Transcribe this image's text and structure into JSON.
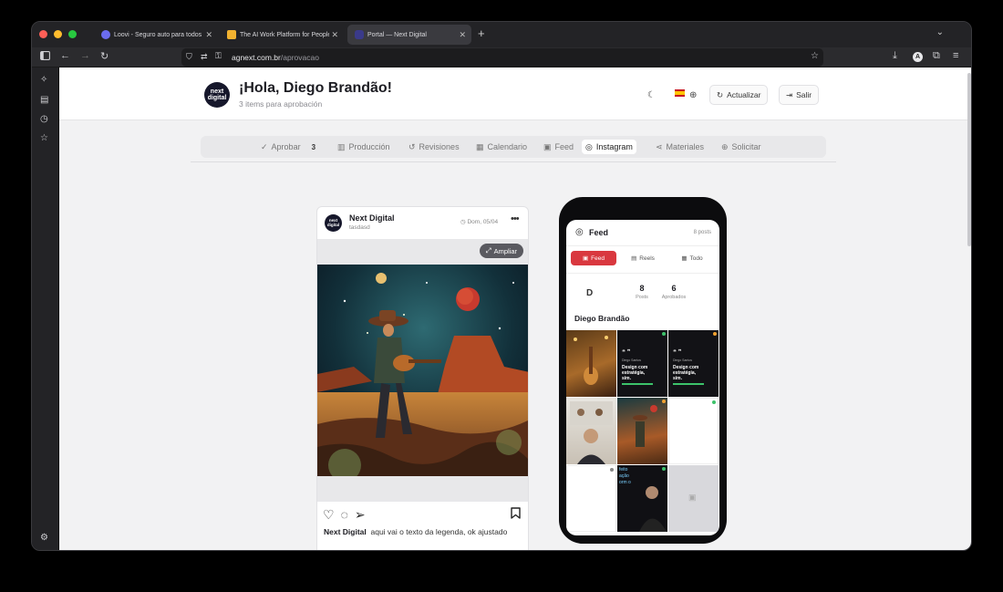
{
  "browser": {
    "tabs": [
      {
        "title": "Loovi - Seguro auto para todos",
        "favicon_color": "#6b6cf0"
      },
      {
        "title": "The AI Work Platform for People",
        "favicon_color": "#f2b230"
      },
      {
        "title": "Portal — Next Digital",
        "favicon_color": "#3a3a8a"
      }
    ],
    "url_host": "agnext.com.br",
    "url_path": "/aprovacao",
    "new_tab": "+",
    "tab_close": "✕"
  },
  "header": {
    "logo_text": "next digital",
    "greeting": "¡Hola, Diego Brandão!",
    "subtitle": "3 items para aprobación",
    "refresh_label": "Actualizar",
    "logout_label": "Salir"
  },
  "nav": {
    "items": [
      {
        "label": "Aprobar",
        "icon": "check-icon",
        "count": "3"
      },
      {
        "label": "Producción",
        "icon": "building-icon"
      },
      {
        "label": "Revisiones",
        "icon": "history-icon"
      },
      {
        "label": "Calendario",
        "icon": "calendar-icon"
      },
      {
        "label": "Feed",
        "icon": "image-icon"
      },
      {
        "label": "Instagram",
        "icon": "instagram-icon",
        "active": true
      },
      {
        "label": "Materiales",
        "icon": "share-icon"
      },
      {
        "label": "Solicitar",
        "icon": "plus-circle-icon"
      }
    ]
  },
  "post": {
    "avatar_text": "next digital",
    "account_name": "Next Digital",
    "handle": "tasdasd",
    "date": "Dom, 05/04",
    "expand_label": "Ampliar",
    "caption_author": "Next Digital",
    "caption_text": "aqui vai o texto da legenda, ok ajustado"
  },
  "phone": {
    "feed_title": "Feed",
    "posts_count_label": "8 posts",
    "tabs": [
      {
        "label": "Feed",
        "active": true
      },
      {
        "label": "Reels"
      },
      {
        "label": "Todo"
      }
    ],
    "profile_initial": "D",
    "stats": [
      {
        "value": "8",
        "label": "Posts"
      },
      {
        "value": "6",
        "label": "Aprobados"
      }
    ],
    "profile_name": "Diego Brandão",
    "grid_text": {
      "quote_mark": "❝ ❞",
      "card_author": "Diego Santos",
      "card_headline": "Design com estratégia, sim.",
      "card_partial": "feito ação orm o"
    }
  },
  "colors": {
    "accent_red": "#d9383f",
    "status_green": "#3cc26a",
    "status_orange": "#f0a030",
    "status_gray": "#888888"
  }
}
